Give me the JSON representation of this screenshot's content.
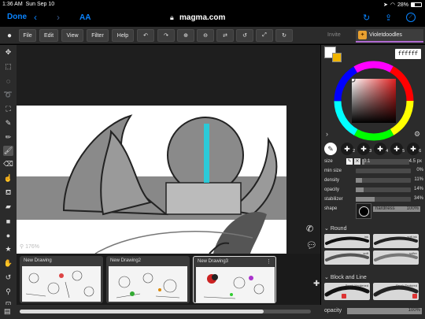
{
  "status_bar": {
    "time": "1:36 AM",
    "date": "Sun Sep 10",
    "battery": "28%"
  },
  "browser": {
    "done_label": "Done",
    "text_size_label": "AA",
    "url": "magma.com"
  },
  "toolbar": {
    "menus": [
      "File",
      "Edit",
      "View",
      "Filter",
      "Help"
    ],
    "invite_label": "Invite",
    "user_name": "Violetdoodles"
  },
  "canvas": {
    "zoom_label": "176%"
  },
  "thumbnails": [
    {
      "title": "New Drawing"
    },
    {
      "title": "New Drawing2"
    },
    {
      "title": "New Drawing3"
    }
  ],
  "color": {
    "hex": "ffffff",
    "primary": "#ffffff",
    "secondary": "#f0b400"
  },
  "brush_slots": [
    "1",
    "2",
    "3",
    "4",
    "5",
    "6"
  ],
  "brush_settings": {
    "size": {
      "label": "size",
      "min": "0.1",
      "value": "4.5 px",
      "level": 0.05
    },
    "min_size": {
      "label": "min size",
      "value": "0%",
      "level": 0
    },
    "density": {
      "label": "density",
      "value": "11%",
      "level": 0.11
    },
    "opacity": {
      "label": "opacity",
      "value": "14%",
      "level": 0.14
    },
    "stabilizer": {
      "label": "stabilizer",
      "value": "34%",
      "level": 0.34
    },
    "shape": {
      "label": "shape",
      "hardness_label": "hardness",
      "hardness_value": "100%"
    }
  },
  "brush_groups": [
    {
      "name": "Round",
      "brushes": [
        "ink",
        "soft ink",
        "soft",
        "softer"
      ]
    },
    {
      "name": "Block and Line",
      "brushes": [
        "Brush Hardened",
        "Brush Textured"
      ]
    }
  ],
  "layer_opacity": {
    "label": "opacity",
    "value": "100%",
    "level": 1.0
  }
}
